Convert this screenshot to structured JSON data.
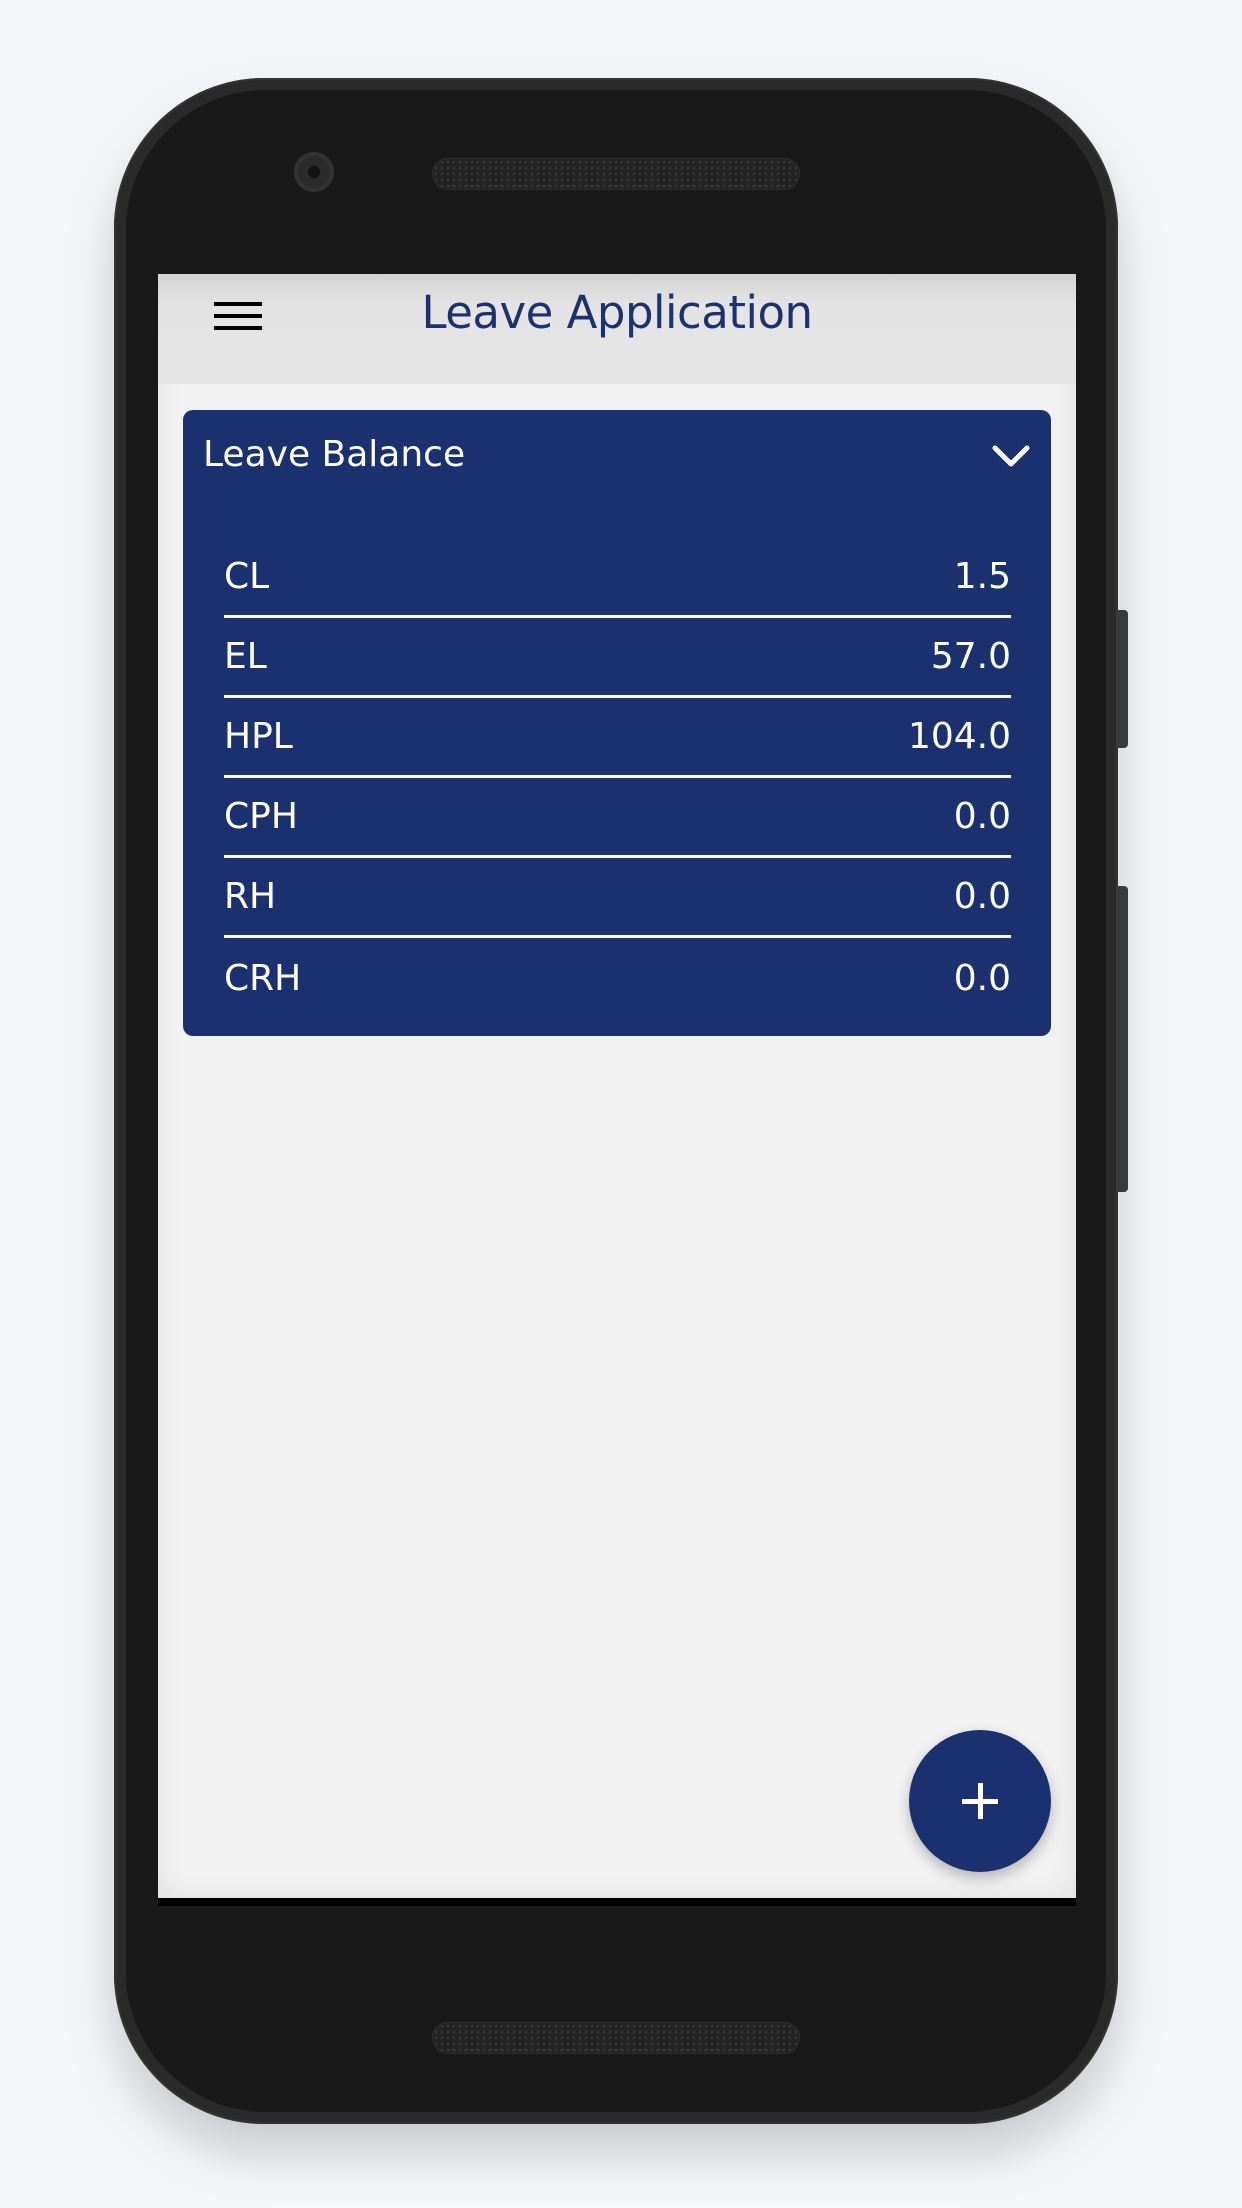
{
  "app_bar": {
    "menu_icon": "hamburger-menu-icon",
    "title": "Leave Application"
  },
  "leave_balance": {
    "title": "Leave Balance",
    "toggle_icon": "chevron-down-icon",
    "expanded": true,
    "items": [
      {
        "label": "CL",
        "value": "1.5"
      },
      {
        "label": "EL",
        "value": "57.0"
      },
      {
        "label": "HPL",
        "value": "104.0"
      },
      {
        "label": "CPH",
        "value": "0.0"
      },
      {
        "label": "RH",
        "value": "0.0"
      },
      {
        "label": "CRH",
        "value": "0.0"
      }
    ]
  },
  "fab": {
    "icon": "plus-icon",
    "action": "add-leave-application"
  },
  "colors": {
    "primary": "#1b306e",
    "app_bar_bg": "#e4e4e4",
    "screen_bg": "#f2f2f3",
    "text_on_primary": "#ffffff"
  }
}
